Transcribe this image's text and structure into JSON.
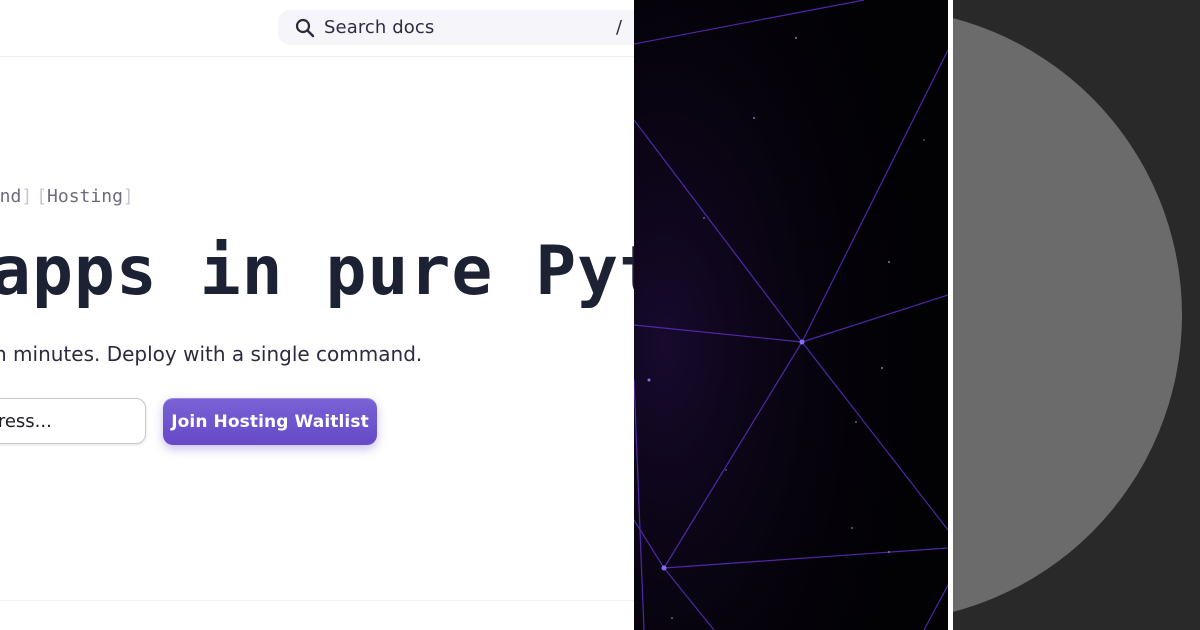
{
  "search": {
    "placeholder": "Search docs",
    "shortcut": "/"
  },
  "hero": {
    "tags": [
      "kend",
      "Hosting"
    ],
    "title": "apps in pure Pyt",
    "subtitle": "n minutes. Deploy with a single command."
  },
  "waitlist": {
    "email_placeholder": "ddress...",
    "button_label": "Join Hosting Waitlist"
  },
  "colors": {
    "accent": "#6549c7",
    "title_text": "#1c2233",
    "network_line": "#5a2fc2",
    "space_background": "#020104",
    "gray_circle": "#6b6b6b",
    "dark_gray": "#292929"
  },
  "icons": {
    "search": "search-icon"
  }
}
